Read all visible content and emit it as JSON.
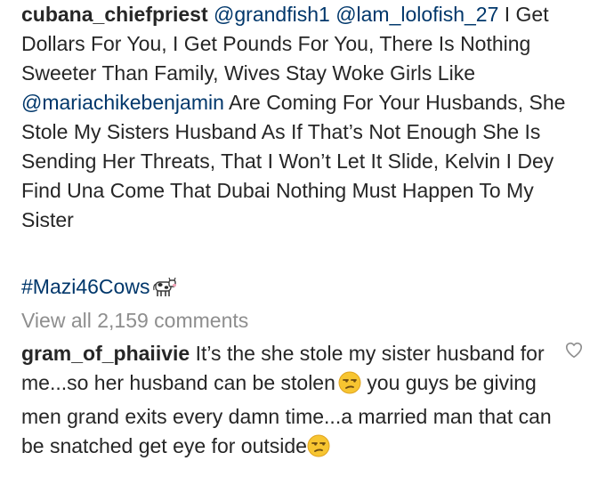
{
  "post": {
    "author": "cubana_chiefpriest",
    "mention_1": "@grandfish1",
    "mention_2": "@lam_lolofish_27",
    "text_1": "I Get Dollars For You, I Get Pounds For You, There Is Nothing Sweeter Than Family, Wives Stay Woke Girls Like",
    "mention_3": "@mariachikebenjamin",
    "text_2": "Are Coming For Your Husbands, She Stole My Sisters Husband As If That’s Not Enough She Is Sending Her Threats, That I Won’t Let It Slide, Kelvin I Dey Find Una Come That Dubai Nothing Must Happen To My Sister",
    "hashtag": "#Mazi46Cows",
    "hashtag_emoji_icon": "cow-icon"
  },
  "comments_link": {
    "label": "View all 2,159 comments"
  },
  "comment": {
    "author": "gram_of_phaiivie",
    "text_1": "It’s the she stole my sister husband for me...so her husband can be stolen",
    "text_2": "you guys be giving men grand exits every damn time...a married man that can be snatched get eye for outside",
    "emoji_icon": "unamused-face-icon",
    "like_icon": "heart-outline-icon"
  },
  "colors": {
    "text": "#262626",
    "link": "#00376b",
    "muted": "#8e8e8e",
    "emoji_face": "#f7c531"
  }
}
